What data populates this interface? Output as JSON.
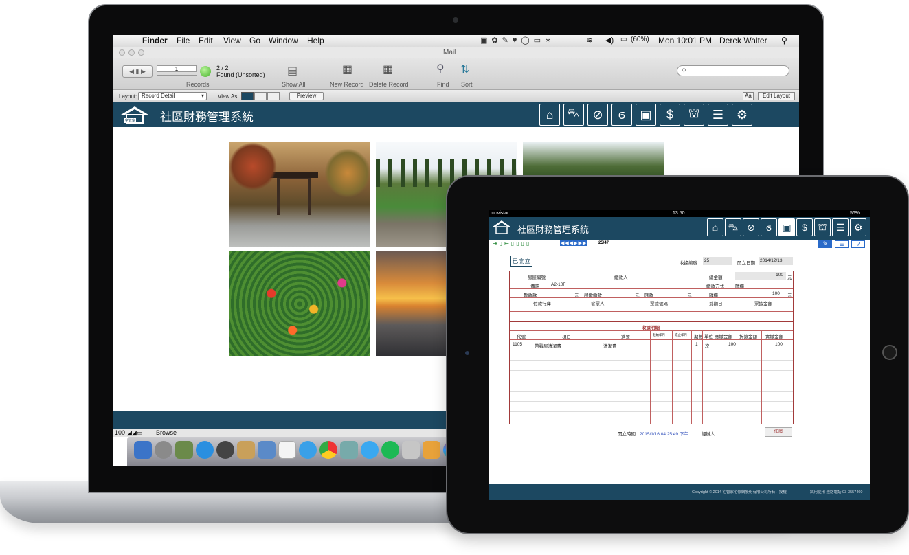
{
  "mac": {
    "menubar": {
      "app": "Finder",
      "menus": [
        "File",
        "Edit",
        "View",
        "Go",
        "Window",
        "Help"
      ],
      "battery": "(60%)",
      "clock": "Mon 10:01 PM",
      "user": "Derek Walter"
    },
    "window_title": "Mail",
    "toolbar": {
      "record_number": "1",
      "record_count": "2 / 2",
      "found_status": "Found (Unsorted)",
      "records_label": "Records",
      "show_all": "Show All",
      "new_record": "New Record",
      "delete_record": "Delete Record",
      "find": "Find",
      "sort": "Sort"
    },
    "layoutbar": {
      "layout_label": "Layout:",
      "layout_value": "Record Detail",
      "view_as_label": "View As:",
      "preview": "Preview",
      "font_btn": "Aa",
      "edit_layout": "Edit Layout"
    },
    "app_title": "社區財務管理系統",
    "logo_text": "宅管家",
    "statusbar": {
      "zoom": "100",
      "mode": "Browse"
    }
  },
  "ipad": {
    "status": {
      "carrier": "movistar",
      "time": "13:50",
      "battery": "56%"
    },
    "app_title": "社區財務管理系統",
    "record_pos": "25/47",
    "status_badge": "已開立",
    "receipt_no_label": "收據編號",
    "receipt_no": "25",
    "issue_date_label": "開立日期",
    "issue_date": "2014/12/13",
    "form": {
      "house_no": "房屋編號",
      "payer": "繳款人",
      "total_label": "總金額",
      "total": "100",
      "yuan": "元",
      "remark": "備註",
      "remark_val": "A2-10F",
      "method_label": "繳款方式",
      "method_val": "隨櫃",
      "prepay": "暫收款",
      "overpay": "超繳繳款",
      "transfer": "匯款",
      "cash": "隨櫃",
      "cash_amt": "100",
      "bank": "付款行庫",
      "drawer": "發票人",
      "check_no": "票據號碼",
      "due": "到期日",
      "check_amt": "票據金額",
      "detail_title": "收據明細",
      "cols": [
        "代號",
        "項目",
        "摘要",
        "起始年月",
        "迄止年月",
        "期數",
        "單位",
        "應繳金額",
        "折讓金額",
        "實繳金額"
      ],
      "row": [
        "1105",
        "帶看屋清潔費",
        "清潔費",
        "",
        "",
        "1",
        "次",
        "100",
        "",
        "100"
      ]
    },
    "issue_time_label": "開立時間",
    "issue_time": "2015/1/16 04:25:49 下午",
    "handler_label": "經辦人",
    "void_btn": "作廢",
    "copyright": "Copyright © 2014 宅管家宅修網股份有限公司所有．授權",
    "contact": "試用使用  連絡電話:03-3557460"
  },
  "colors": {
    "header": "#1c4861",
    "accent": "#a23a3a"
  }
}
